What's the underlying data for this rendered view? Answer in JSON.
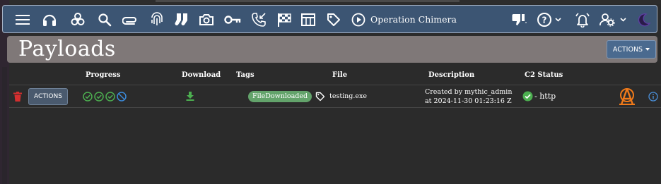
{
  "header": {
    "operation_name": "Operation Chimera",
    "nav_icons": [
      "menu-icon",
      "headphones-icon",
      "biohazard-icon",
      "search-icon",
      "paperclip-icon",
      "fingerprint-icon",
      "socks-icon",
      "camera-icon",
      "key-icon",
      "phone-callback-icon",
      "checkered-flag-icon",
      "table-icon",
      "tag-icon",
      "play-circle-icon"
    ],
    "right_icons": [
      "thumb-down-icon",
      "help-icon",
      "bell-alert-icon",
      "user-settings-icon",
      "moon-icon"
    ]
  },
  "page": {
    "title": "Payloads",
    "actions_label": "ACTIONS"
  },
  "table": {
    "columns": [
      "Progress",
      "Download",
      "Tags",
      "File",
      "Description",
      "C2 Status"
    ],
    "rows": [
      {
        "actions_label": "ACTIONS",
        "progress": [
          "done",
          "done",
          "done",
          "skipped"
        ],
        "tag": "FileDownloaded",
        "file": "testing.exe",
        "description_line1": "Created by mythic_admin",
        "description_line2": "at 2024-11-30 01:23:16 Z",
        "c2_status": "- http"
      }
    ]
  },
  "colors": {
    "topbar": "#3c5573",
    "titlebar": "#7f7878",
    "background": "#2b2b2b",
    "success": "#4caf50",
    "delete": "#d32f2f",
    "tag_chip": "#63a36b",
    "agent_logo": "#f07a1a",
    "info": "#4a8fd9"
  }
}
